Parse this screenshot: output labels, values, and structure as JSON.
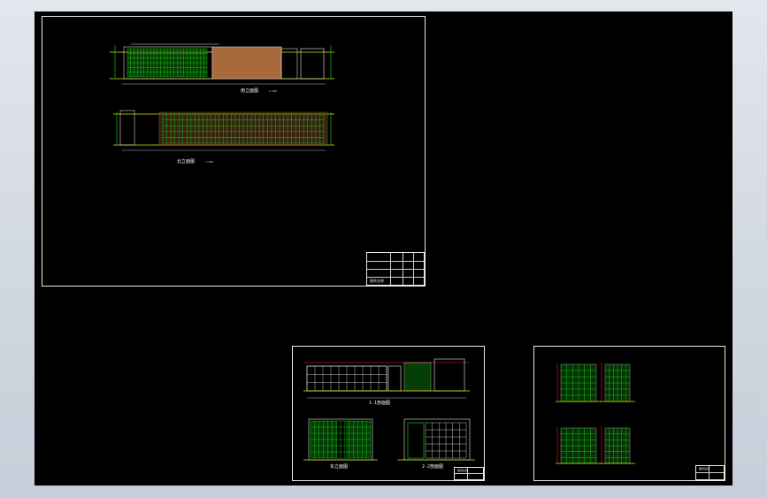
{
  "app": {
    "kind": "cad-drawing-viewer",
    "background": "#000000",
    "line_colors": {
      "green": "#18e018",
      "yellow": "#e6e600",
      "red": "#ff2020",
      "orange": "#c07828",
      "white": "#e8e8e8",
      "magenta": "#d040d0"
    }
  },
  "sheets": [
    {
      "id": "sheet-elevations",
      "drawings": [
        {
          "title": "南立面图",
          "scale": "1:100"
        },
        {
          "title": "北立面图",
          "scale": "1:100"
        }
      ]
    },
    {
      "id": "sheet-sections",
      "drawings": [
        {
          "title": "1-1剖面图",
          "scale": ""
        },
        {
          "title": "东立面图",
          "scale": ""
        },
        {
          "title": "2-2剖面图",
          "scale": ""
        }
      ]
    },
    {
      "id": "sheet-side-elevations",
      "drawings": []
    }
  ],
  "title_blocks": [
    {
      "sheet": "sheet-elevations",
      "label": "图纸名称"
    },
    {
      "sheet": "sheet-sections",
      "label": "图纸名称"
    },
    {
      "sheet": "sheet-side-elevations",
      "label": "图纸名称"
    }
  ]
}
